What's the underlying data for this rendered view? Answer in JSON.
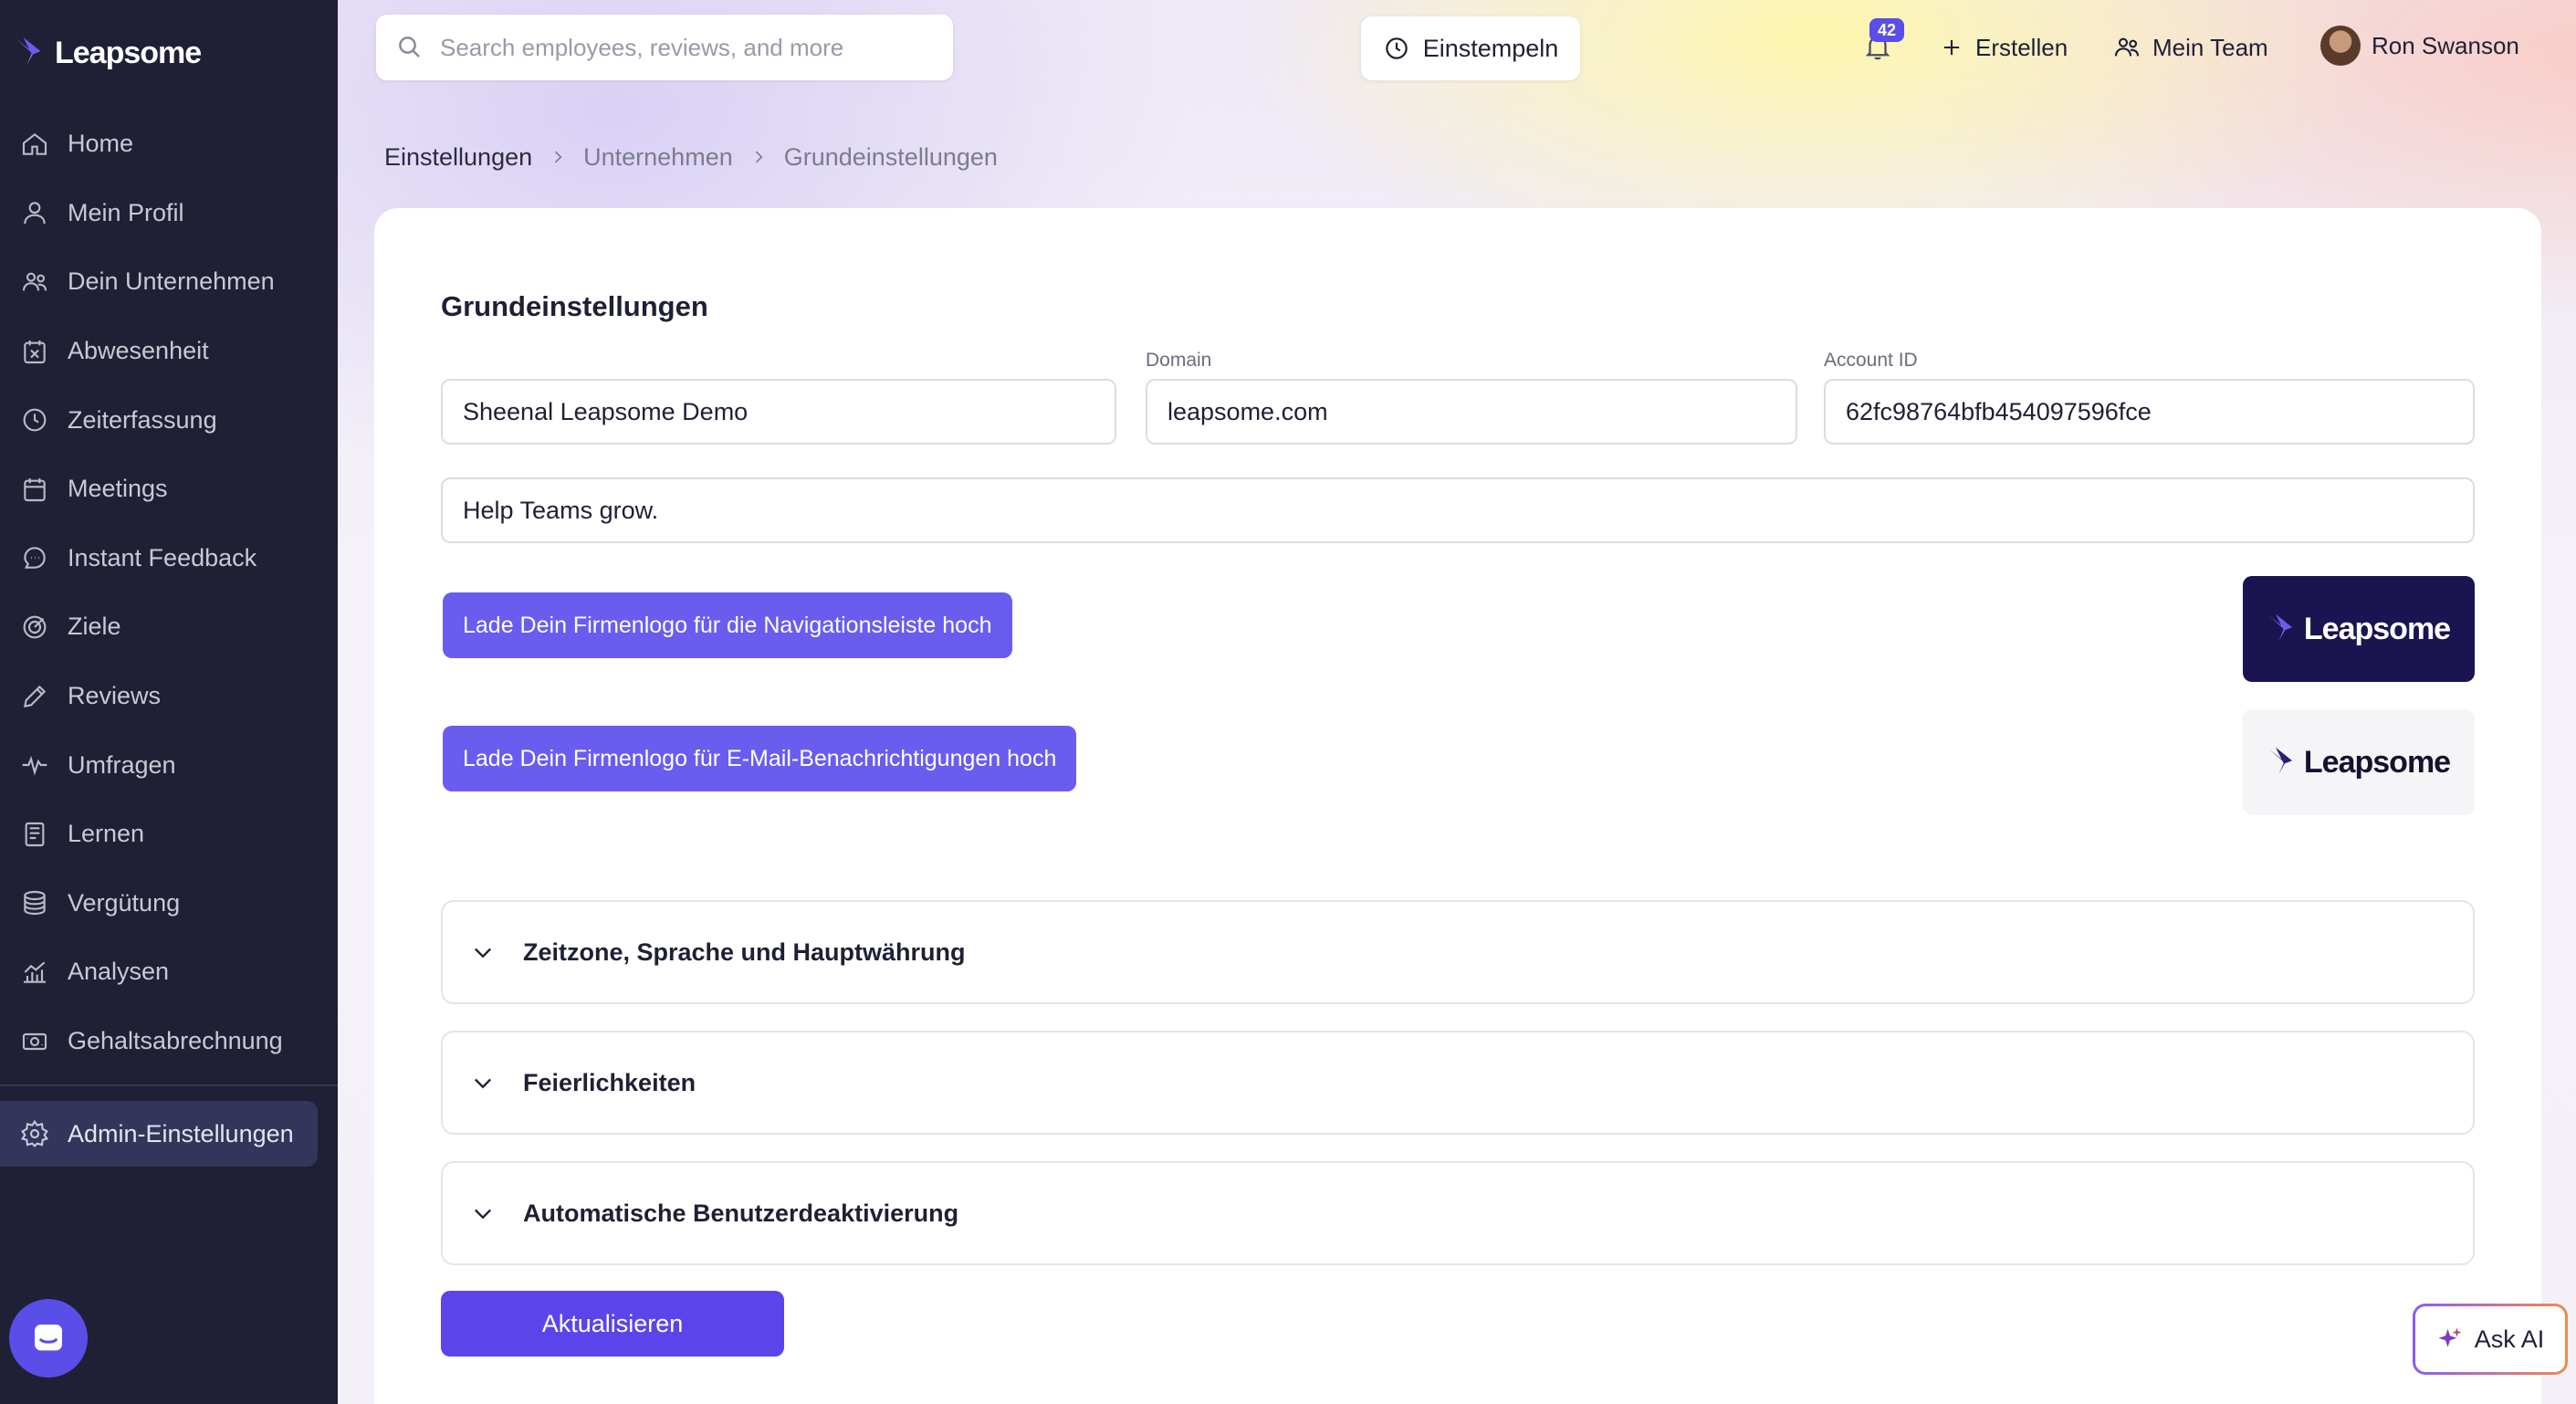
{
  "app": {
    "name": "Leapsome"
  },
  "sidebar": {
    "items": [
      {
        "label": "Home",
        "icon": "home-icon"
      },
      {
        "label": "Mein Profil",
        "icon": "user-icon"
      },
      {
        "label": "Dein Unternehmen",
        "icon": "users-icon"
      },
      {
        "label": "Abwesenheit",
        "icon": "calendar-x-icon"
      },
      {
        "label": "Zeiterfassung",
        "icon": "clock-icon"
      },
      {
        "label": "Meetings",
        "icon": "calendar-icon"
      },
      {
        "label": "Instant Feedback",
        "icon": "chat-icon"
      },
      {
        "label": "Ziele",
        "icon": "target-icon"
      },
      {
        "label": "Reviews",
        "icon": "pencil-icon"
      },
      {
        "label": "Umfragen",
        "icon": "pulse-icon"
      },
      {
        "label": "Lernen",
        "icon": "book-icon"
      },
      {
        "label": "Vergütung",
        "icon": "coins-icon"
      },
      {
        "label": "Analysen",
        "icon": "chart-icon"
      },
      {
        "label": "Gehaltsabrechnung",
        "icon": "money-icon"
      }
    ],
    "active_item": {
      "label": "Admin-Einstellungen",
      "icon": "gear-icon"
    }
  },
  "topbar": {
    "search_placeholder": "Search employees, reviews, and more",
    "clock_in_label": "Einstempeln",
    "notifications_count": "42",
    "create_label": "Erstellen",
    "my_team_label": "Mein Team",
    "user_name": "Ron Swanson"
  },
  "breadcrumb": {
    "items": [
      "Einstellungen",
      "Unternehmen",
      "Grundeinstellungen"
    ]
  },
  "settings": {
    "title": "Grundeinstellungen",
    "company_name_value": "Sheenal Leapsome Demo",
    "domain_label": "Domain",
    "domain_value": "leapsome.com",
    "account_id_label": "Account ID",
    "account_id_value": "62fc98764bfb454097596fce",
    "slogan_value": "Help Teams grow.",
    "upload_nav_logo_label": "Lade Dein Firmenlogo für die Navigationsleiste hoch",
    "upload_email_logo_label": "Lade Dein Firmenlogo für E-Mail-Benachrichtigungen hoch",
    "nav_logo_preview_text": "Leapsome",
    "email_logo_preview_text": "Leapsome",
    "accordions": [
      "Zeitzone, Sprache und Hauptwährung",
      "Feierlichkeiten",
      "Automatische Benutzerdeaktivierung"
    ],
    "submit_label": "Aktualisieren"
  },
  "ask_ai_label": "Ask AI",
  "colors": {
    "sidebar_bg": "#1f2035",
    "accent": "#5b45ea",
    "upload_button": "#6b5cf0",
    "nav_logo_bg": "#1a1450"
  }
}
